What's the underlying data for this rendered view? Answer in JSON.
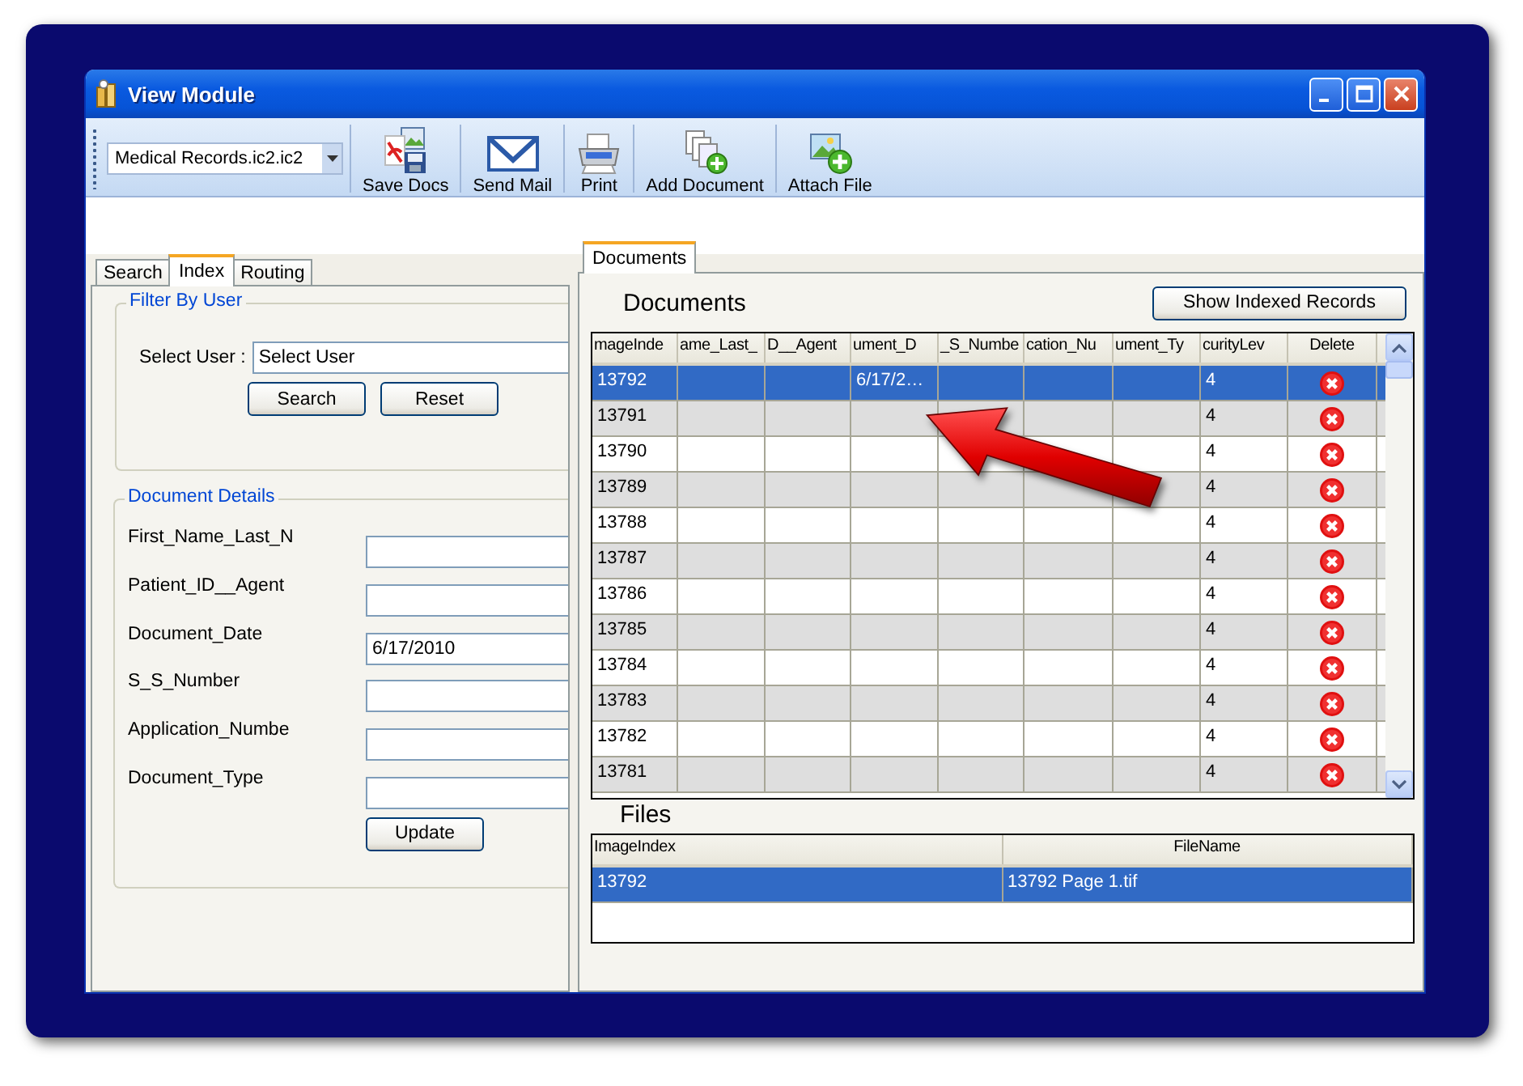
{
  "window": {
    "title": "View Module"
  },
  "toolbar": {
    "database": {
      "value": "Medical Records.ic2.ic2"
    },
    "buttons": [
      {
        "label": "Save Docs"
      },
      {
        "label": "Send Mail"
      },
      {
        "label": "Print"
      },
      {
        "label": "Add Document"
      },
      {
        "label": "Attach File"
      }
    ]
  },
  "left_tabs": [
    {
      "label": "Search",
      "selected": false
    },
    {
      "label": "Index",
      "selected": true
    },
    {
      "label": "Routing",
      "selected": false
    }
  ],
  "filter": {
    "legend": "Filter By User",
    "label": "Select User :",
    "value": "Select User",
    "buttons": [
      "Search",
      "Reset"
    ]
  },
  "details": {
    "legend": "Document Details",
    "fields": [
      {
        "label": "First_Name_Last_N"
      },
      {
        "label": "Patient_ID__Agent"
      },
      {
        "label": "Document_Date",
        "value": "6/17/2010"
      },
      {
        "label": "S_S_Number"
      },
      {
        "label": "Application_Numbe"
      },
      {
        "label": "Document_Type"
      }
    ],
    "button": "Update"
  },
  "right_tabs": [
    {
      "label": "Documents",
      "selected": true
    }
  ],
  "documents": {
    "heading": "Documents",
    "button": "Show Indexed Records",
    "columns": [
      "mageInde",
      "ame_Last_",
      "D__Agent",
      "ument_D",
      "_S_Numbe",
      "cation_Nu",
      "ument_Ty",
      "curityLev",
      "Delete"
    ],
    "rows": [
      {
        "image_index": "13792",
        "document_date": "6/17/2…",
        "security_level": "4",
        "selected": true
      },
      {
        "image_index": "13791",
        "security_level": "4",
        "selected": false
      },
      {
        "image_index": "13790",
        "security_level": "4",
        "selected": false
      },
      {
        "image_index": "13789",
        "security_level": "4",
        "selected": false
      },
      {
        "image_index": "13788",
        "security_level": "4",
        "selected": false
      },
      {
        "image_index": "13787",
        "security_level": "4",
        "selected": false
      },
      {
        "image_index": "13786",
        "security_level": "4",
        "selected": false
      },
      {
        "image_index": "13785",
        "security_level": "4",
        "selected": false
      },
      {
        "image_index": "13784",
        "security_level": "4",
        "selected": false
      },
      {
        "image_index": "13783",
        "security_level": "4",
        "selected": false
      },
      {
        "image_index": "13782",
        "security_level": "4",
        "selected": false
      },
      {
        "image_index": "13781",
        "security_level": "4",
        "selected": false
      }
    ]
  },
  "files": {
    "heading": "Files",
    "columns": [
      "ImageIndex",
      "FileName"
    ],
    "rows": [
      {
        "image_index": "13792",
        "file_name": "13792 Page 1.tif",
        "selected": true
      }
    ]
  }
}
